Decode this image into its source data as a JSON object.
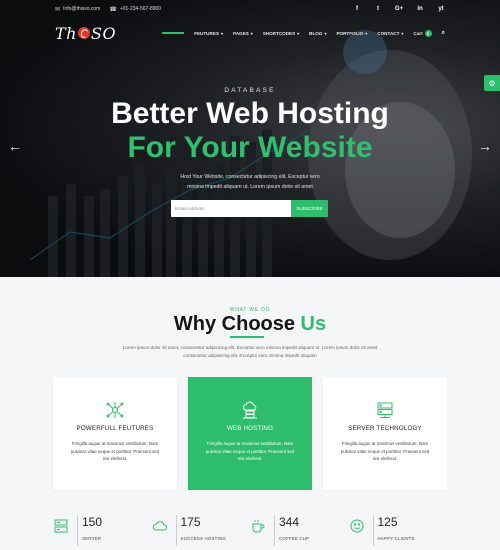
{
  "topbar": {
    "email": "Info@thisso.com",
    "phone": "+01-234-567-8900",
    "social": [
      "f",
      "t",
      "G+",
      "in",
      "yt"
    ]
  },
  "nav": {
    "logo": "ThSO",
    "items": [
      {
        "label": "FEUTURES"
      },
      {
        "label": "PAGES"
      },
      {
        "label": "SHORTCODES"
      },
      {
        "label": "BLOG"
      },
      {
        "label": "PORTFOLIO"
      },
      {
        "label": "CONTACT"
      }
    ],
    "cart_label": "Cart",
    "cart_count": "0"
  },
  "hero": {
    "eyebrow": "DATABASE",
    "title_line1": "Better Web Hosting",
    "title_line2": "For Your Website",
    "desc_line1": "Host Your Website, consectetur adipiscing elit. Exceptui vero",
    "desc_line2": "minima impedit aliquam ut. Lorem ipsum dolor sit amet",
    "email_placeholder": "Email Address",
    "subscribe_label": "SUBSCRIBE",
    "arrow_left": "←",
    "arrow_right": "→"
  },
  "why": {
    "eyebrow": "WHAT WE DO",
    "title_prefix": "Why ",
    "title_highlight": "Choose",
    "title_suffix": " Us",
    "desc_line1": "Lorem ipsum dolor sit amet, consectetur adipisicing elit. Exceptui vero minima impedit aliquam ut. Lorem ipsum dolor sit amet",
    "desc_line2": "consectetur adipisicing elit. Exceptui vero minima impedit aliquam"
  },
  "cards": [
    {
      "title": "POWERFULL FEUTURES",
      "icon": "network-icon",
      "active": false,
      "line1": "Fringilla augue at maximus vestibulum. Nam",
      "line2": "pulvinar vitae neque et porttitor. Praesent sed",
      "line3": "nisi eleifend."
    },
    {
      "title": "WEB HOSTING",
      "icon": "cloud-hosting-icon",
      "active": true,
      "line1": "Fringilla augue at maximus vestibulum. Nam",
      "line2": "pulvinar vitae neque et porttitor. Praesent sed",
      "line3": "nisi eleifend."
    },
    {
      "title": "SERVER TECHNOLOGY",
      "icon": "server-icon",
      "active": false,
      "line1": "Fringilla augue at maximus vestibulum. Nam",
      "line2": "pulvinar vitae neque et porttitor. Praesent sed",
      "line3": "nisi eleifend."
    }
  ],
  "stats": [
    {
      "value": "150",
      "label": "SERVER",
      "icon": "server-stat-icon"
    },
    {
      "value": "175",
      "label": "SUCCESS HOSTING",
      "icon": "cloud-stat-icon"
    },
    {
      "value": "344",
      "label": "COFFEE CUP",
      "icon": "coffee-icon"
    },
    {
      "value": "125",
      "label": "HAPPY CLIENTS",
      "icon": "smiley-icon"
    }
  ],
  "colors": {
    "accent": "#2ebd6d",
    "hero_dark": "#0d0f12",
    "section_bg": "#f5f6f7"
  }
}
